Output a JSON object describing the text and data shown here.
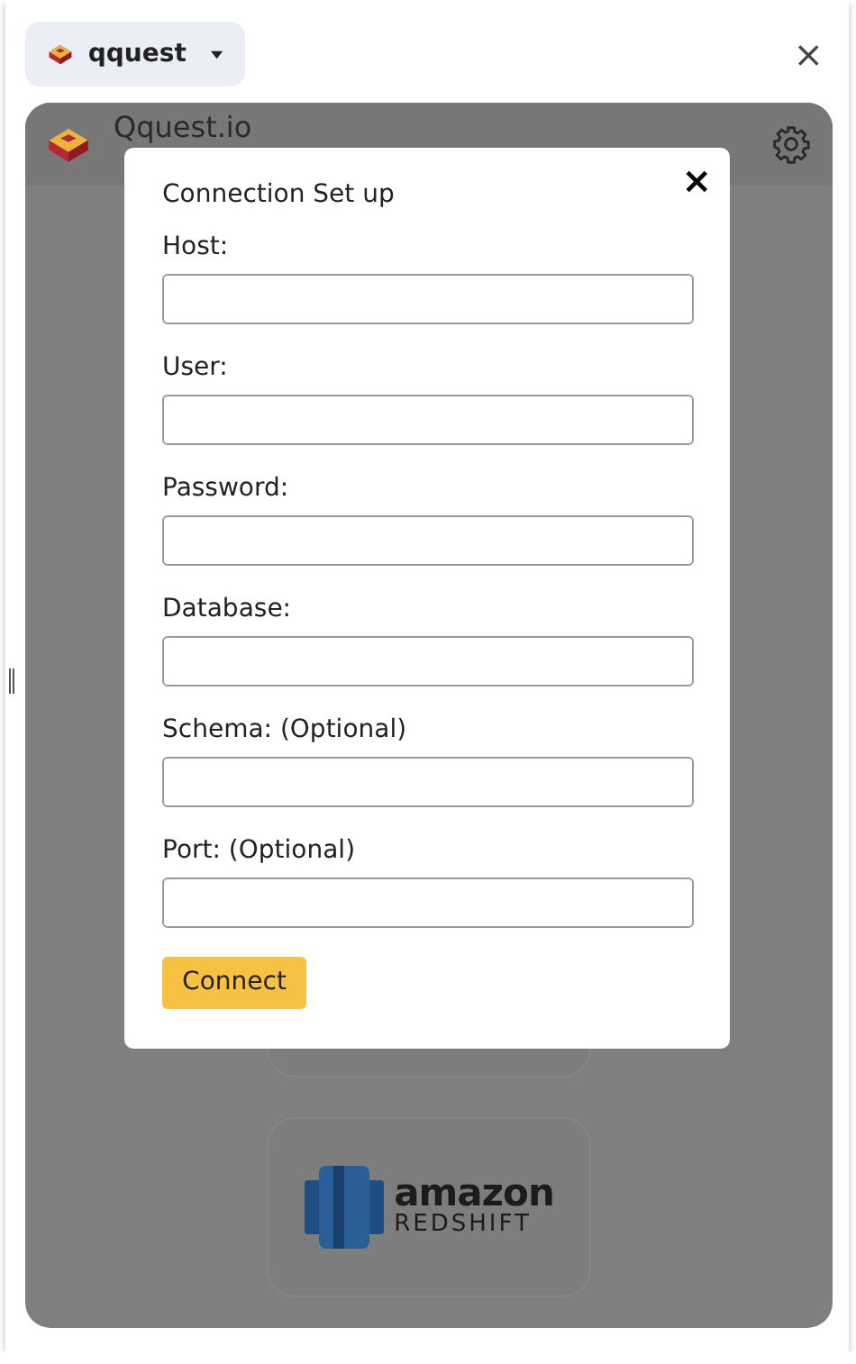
{
  "tab": {
    "label": "qquest",
    "close": "×"
  },
  "app": {
    "title": "Qquest.io"
  },
  "cards": [
    {
      "kind": "blank"
    },
    {
      "kind": "redshift",
      "line_1": "amazon",
      "line_2": "REDSHIFT"
    }
  ],
  "modal": {
    "title": "Connection Set up",
    "close": "×",
    "fields": [
      {
        "label": "Host:"
      },
      {
        "label": "User:"
      },
      {
        "label": "Password:"
      },
      {
        "label": "Database:"
      },
      {
        "label": "Schema: (Optional)"
      },
      {
        "label": "Port: (Optional)"
      }
    ],
    "submit": "Connect"
  }
}
